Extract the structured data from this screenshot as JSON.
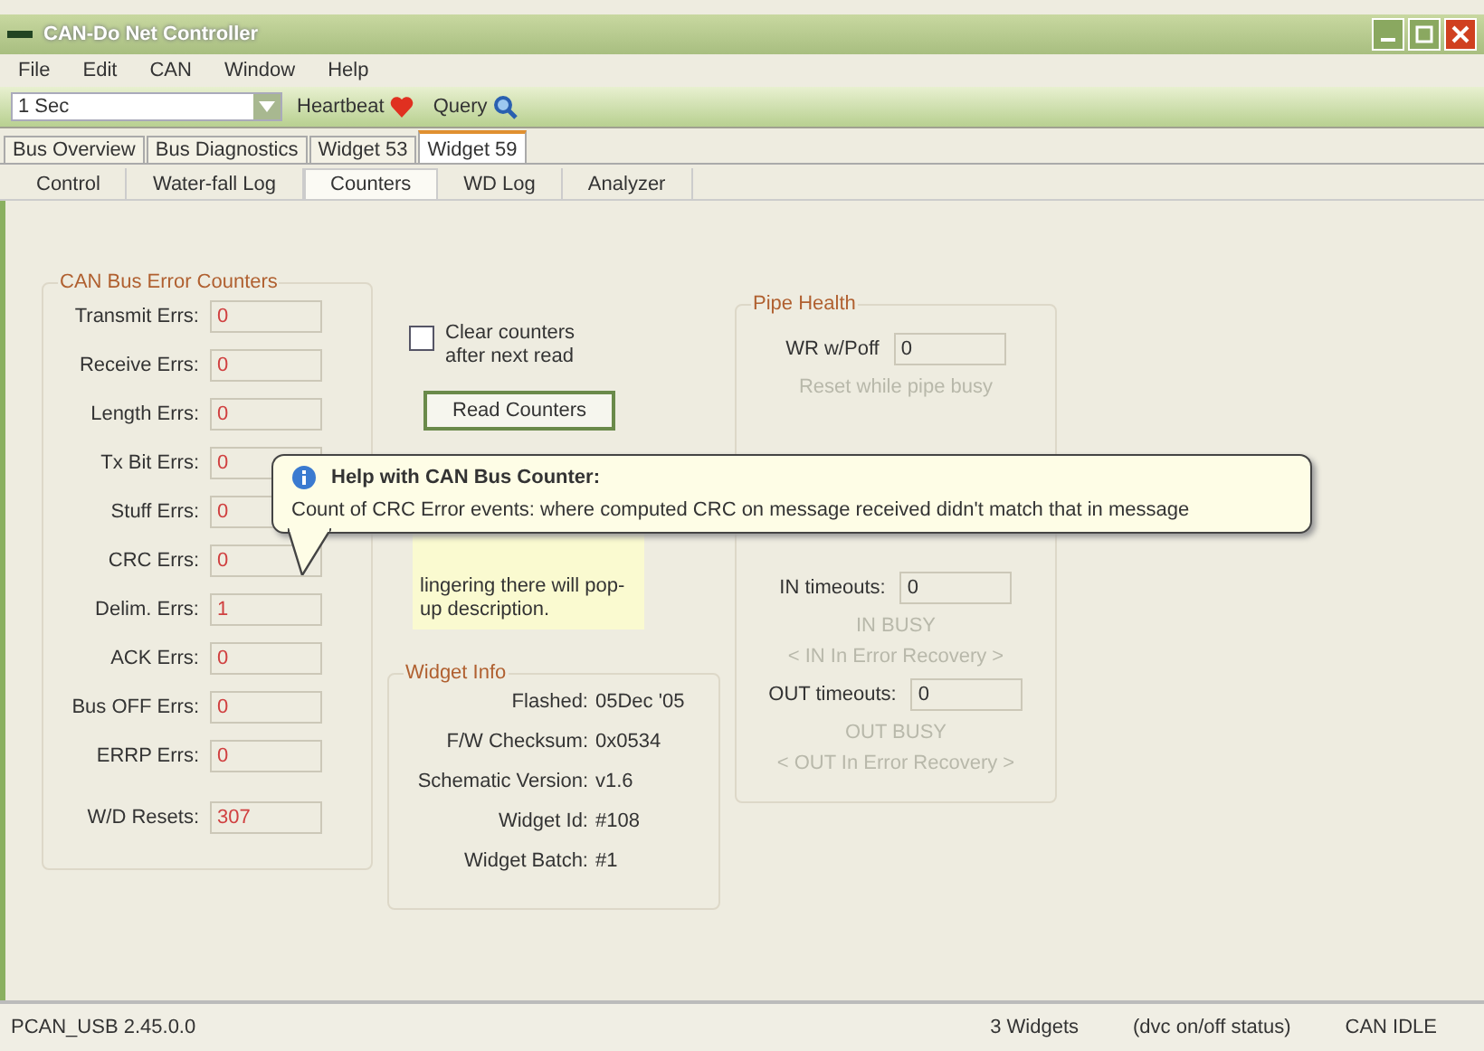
{
  "window": {
    "title": "CAN-Do Net Controller"
  },
  "menu": [
    "File",
    "Edit",
    "CAN",
    "Window",
    "Help"
  ],
  "toolbar": {
    "interval": "1 Sec",
    "heartbeat": "Heartbeat",
    "query": "Query"
  },
  "tabs": [
    {
      "label": "Bus Overview",
      "selected": false
    },
    {
      "label": "Bus Diagnostics",
      "selected": false
    },
    {
      "label": "Widget 53",
      "selected": false
    },
    {
      "label": "Widget 59",
      "selected": true
    }
  ],
  "subtabs": [
    {
      "label": "Control",
      "selected": false
    },
    {
      "label": "Water-fall Log",
      "selected": false
    },
    {
      "label": "Counters",
      "selected": true
    },
    {
      "label": "WD Log",
      "selected": false
    },
    {
      "label": "Analyzer",
      "selected": false
    }
  ],
  "error_counters": {
    "title": "CAN Bus Error Counters",
    "rows": [
      {
        "label": "Transmit Errs:",
        "value": "0"
      },
      {
        "label": "Receive Errs:",
        "value": "0"
      },
      {
        "label": "Length Errs:",
        "value": "0"
      },
      {
        "label": "Tx Bit Errs:",
        "value": "0"
      },
      {
        "label": "Stuff Errs:",
        "value": "0"
      },
      {
        "label": "CRC Errs:",
        "value": "0"
      },
      {
        "label": "Delim. Errs:",
        "value": "1"
      },
      {
        "label": "ACK Errs:",
        "value": "0"
      },
      {
        "label": "Bus OFF Errs:",
        "value": "0"
      },
      {
        "label": "ERRP Errs:",
        "value": "0"
      }
    ],
    "wd_resets": {
      "label": "W/D Resets:",
      "value": "307"
    }
  },
  "clear_option": {
    "label": "Clear counters after next read",
    "checked": false
  },
  "read_button": "Read Counters",
  "note": "lingering there will pop-up description.",
  "widget_info": {
    "title": "Widget Info",
    "rows": [
      {
        "label": "Flashed:",
        "value": "05Dec '05"
      },
      {
        "label": "F/W Checksum:",
        "value": "0x0534"
      },
      {
        "label": "Schematic Version:",
        "value": "v1.6"
      },
      {
        "label": "Widget Id:",
        "value": "#108"
      },
      {
        "label": "Widget Batch:",
        "value": "#1"
      }
    ]
  },
  "pipe_health": {
    "title": "Pipe Health",
    "items": [
      {
        "kind": "field",
        "label": "WR w/Poff",
        "value": "0"
      },
      {
        "kind": "status",
        "text": "Reset while pipe busy"
      },
      {
        "kind": "gap"
      },
      {
        "kind": "field",
        "label": "IN timeouts:",
        "value": "0"
      },
      {
        "kind": "status",
        "text": "IN BUSY"
      },
      {
        "kind": "status",
        "text": "< IN  In Error Recovery >"
      },
      {
        "kind": "field",
        "label": "OUT timeouts:",
        "value": "0"
      },
      {
        "kind": "status",
        "text": "OUT BUSY"
      },
      {
        "kind": "status",
        "text": "< OUT In Error Recovery >"
      }
    ]
  },
  "tooltip": {
    "title": "Help with CAN Bus Counter:",
    "text": "Count of CRC Error events: where computed CRC on message received didn't match that in message"
  },
  "status_bar": [
    "PCAN_USB 2.45.0.0",
    "3 Widgets",
    "(dvc on/off status)",
    "CAN IDLE"
  ]
}
